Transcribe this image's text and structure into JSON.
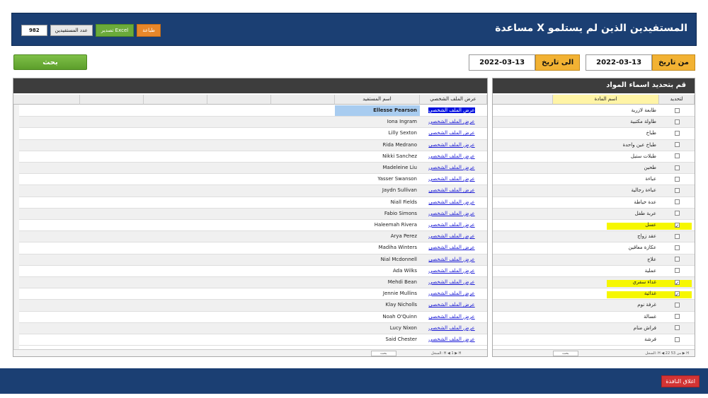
{
  "header": {
    "title": "المستفيدين الذين لم يستلمو X مساعدة",
    "print_label": "طباعة",
    "excel_label": "تصدير Excel",
    "count_label": "عدد المستفيدين",
    "count_value": "982"
  },
  "filters": {
    "from_label": "من تاريخ",
    "from_value": "2022-03-13",
    "to_label": "الى تاريخ",
    "to_value": "2022-03-13",
    "search_label": "بحث"
  },
  "materials_panel": {
    "title": "قم بتحديد اسماء المواد",
    "col_select": "لتحديد",
    "col_name": "اسم المادة",
    "footer": "السجل: H ◀ 22 من 53 ▶ H",
    "footer_search": "بحث",
    "items": [
      {
        "name": "طابعة لازرية",
        "checked": false
      },
      {
        "name": "طاولة مكتبية",
        "checked": false
      },
      {
        "name": "طباخ",
        "checked": false
      },
      {
        "name": "طباخ عين واحدة",
        "checked": false
      },
      {
        "name": "طبلات ستيل",
        "checked": false
      },
      {
        "name": "طحين",
        "checked": false
      },
      {
        "name": "عباءة",
        "checked": false
      },
      {
        "name": "عباءة رجالية",
        "checked": false
      },
      {
        "name": "عدة خياطة",
        "checked": false
      },
      {
        "name": "عربة طفل",
        "checked": false
      },
      {
        "name": "عسل",
        "checked": true
      },
      {
        "name": "عقد زواج",
        "checked": false
      },
      {
        "name": "عكازة معاقين",
        "checked": false
      },
      {
        "name": "علاج",
        "checked": false
      },
      {
        "name": "عملية",
        "checked": false
      },
      {
        "name": "غداء سفري",
        "checked": true
      },
      {
        "name": "غذائية",
        "checked": true
      },
      {
        "name": "غرفة نوم",
        "checked": false
      },
      {
        "name": "غسالة",
        "checked": false
      },
      {
        "name": "فراش منام",
        "checked": false
      },
      {
        "name": "فرشة",
        "checked": false
      }
    ]
  },
  "beneficiaries_panel": {
    "col_profile": "عرض الملف الشخصي",
    "col_name": "اسم المستفيد",
    "profile_link": "عرض الملف الشخصي",
    "footer": "السجل: H ◀ 1 ▶ H",
    "footer_search": "بحث",
    "names": [
      "Ellesse Pearson",
      "Iona Ingram",
      "Lilly Sexton",
      "Rida Medrano",
      "Nikki Sanchez",
      "Madeleine Liu",
      "Yasser Swanson",
      "Jaydn Sullivan",
      "Niall Fields",
      "Fabio Simons",
      "Haleemah Rivera",
      "Arya Perez",
      "Madiha Winters",
      "Nial Mcdonnell",
      "Ada Wilks",
      "Mehdi Bean",
      "Jennie Mullins",
      "Klay Nicholls",
      "Noah O'Quinn",
      "Lucy Nixon",
      "Said Chester"
    ]
  },
  "footer": {
    "close_label": "اغلاق النافذة"
  }
}
